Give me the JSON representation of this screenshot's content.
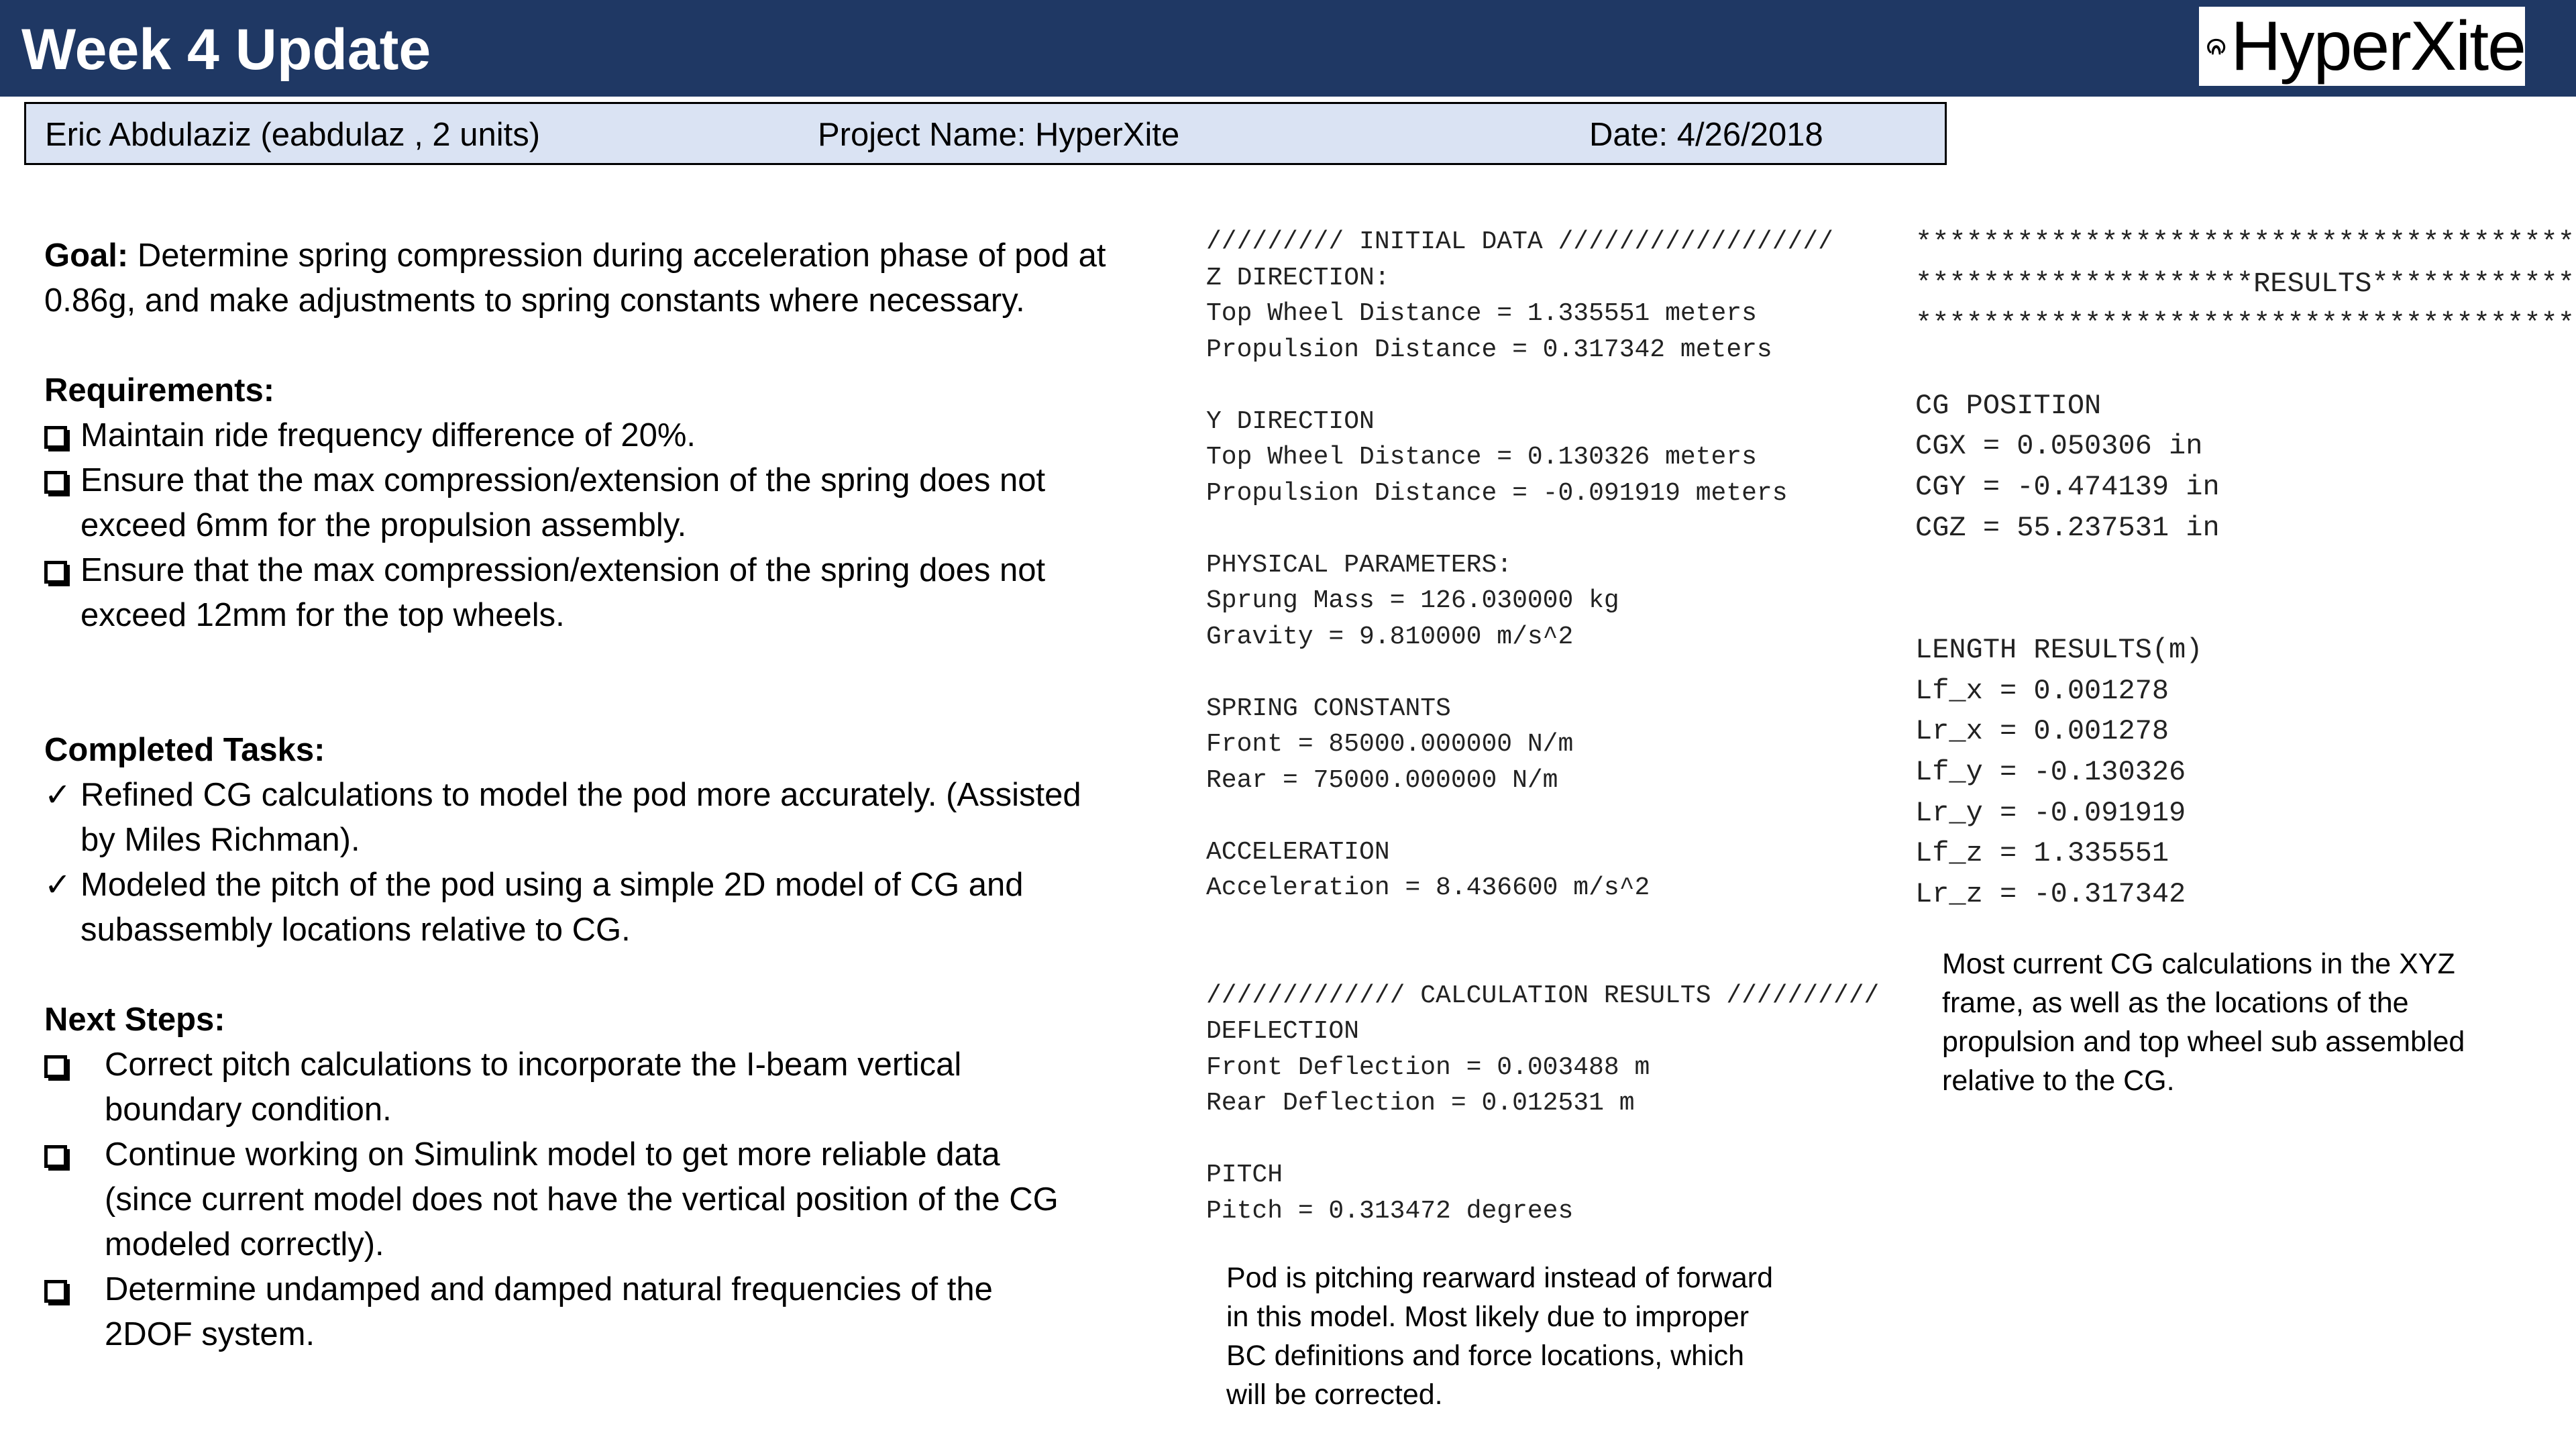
{
  "header": {
    "title": "Week 4 Update",
    "logo_text": "HyperXite",
    "bg_color": "#1f3864"
  },
  "info_bar": {
    "name": "Eric Abdulaziz (eabdulaz , 2 units)",
    "project": "Project Name: HyperXite",
    "date": "Date: 4/26/2018",
    "bg_color": "#dae3f3"
  },
  "goal": {
    "label": "Goal:",
    "text": " Determine spring compression during acceleration phase of pod at",
    "text2": "0.86g, and make adjustments to spring constants where necessary."
  },
  "requirements": {
    "heading": "Requirements:",
    "items": [
      {
        "line1": "Maintain ride frequency difference of 20%.",
        "line2": ""
      },
      {
        "line1": "Ensure that the max compression/extension of the spring does not",
        "line2": "exceed 6mm for the propulsion assembly."
      },
      {
        "line1": "Ensure that the max compression/extension of the spring does not",
        "line2": "exceed 12mm for the top wheels."
      }
    ]
  },
  "completed_tasks": {
    "heading": "Completed Tasks:",
    "items": [
      {
        "line1": "Refined CG calculations to model the pod more accurately. (Assisted",
        "line2": "by Miles Richman)."
      },
      {
        "line1": "Modeled the pitch of the pod using a simple 2D model of CG and",
        "line2": "subassembly locations relative to CG."
      }
    ]
  },
  "next_steps": {
    "heading": "Next Steps:",
    "items": [
      {
        "lines": [
          "Correct pitch calculations to incorporate the I-beam vertical",
          "boundary condition."
        ]
      },
      {
        "lines": [
          "Continue working on Simulink model to get more reliable data",
          "(since current model does not have the vertical position of the CG",
          "modeled correctly)."
        ]
      },
      {
        "lines": [
          "Determine undamped and damped natural frequencies of the",
          "2DOF system."
        ]
      }
    ]
  },
  "output_left": [
    "///////// INITIAL DATA //////////////////",
    "Z DIRECTION:",
    "Top Wheel Distance = 1.335551 meters",
    "Propulsion Distance = 0.317342 meters",
    "",
    "Y DIRECTION",
    "Top Wheel Distance = 0.130326 meters",
    "Propulsion Distance = -0.091919 meters",
    "",
    "PHYSICAL PARAMETERS:",
    "Sprung Mass = 126.030000 kg",
    "Gravity = 9.810000 m/s^2",
    "",
    "SPRING CONSTANTS",
    "Front = 85000.000000 N/m",
    "Rear = 75000.000000 N/m",
    "",
    "ACCELERATION",
    "Acceleration = 8.436600 m/s^2",
    "",
    "",
    "///////////// CALCULATION RESULTS //////////",
    "DEFLECTION",
    "Front Deflection = 0.003488 m",
    "Rear Deflection = 0.012531 m",
    "",
    "PITCH",
    "Pitch = 0.313472 degrees"
  ],
  "output_right": [
    "****************************************",
    "********************RESULTS*************",
    "****************************************",
    "",
    "CG POSITION",
    "CGX = 0.050306 in",
    "CGY = -0.474139 in",
    "CGZ = 55.237531 in",
    "",
    "",
    "LENGTH RESULTS(m)",
    "Lf_x = 0.001278",
    "Lr_x = 0.001278",
    "Lf_y = -0.130326",
    "Lr_y = -0.091919",
    "Lf_z = 1.335551",
    "Lr_z = -0.317342"
  ],
  "note_cg": [
    "Most current CG calculations in the XYZ",
    "frame, as well as the locations of the",
    "propulsion and top wheel sub assembled",
    "relative to the CG."
  ],
  "note_pitch": [
    "Pod is pitching rearward instead of forward",
    "in this model. Most likely due to improper",
    "BC definitions and force locations, which",
    "will be corrected."
  ]
}
